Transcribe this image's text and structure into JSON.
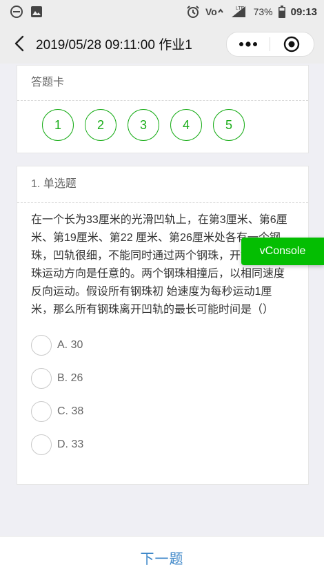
{
  "status_bar": {
    "icons_left": [
      "minus-circle-icon",
      "image-icon"
    ],
    "icons_right": [
      "alarm-icon",
      "volte-icon",
      "signal-icon"
    ],
    "lte_label": "LTE",
    "battery_percent": "73%",
    "time": "09:13"
  },
  "nav": {
    "title": "2019/05/28 09:11:00 作业1",
    "back_icon": "chevron-left-icon",
    "more_icon": "more-dots-icon",
    "close_icon": "record-circle-icon"
  },
  "answer_card": {
    "title": "答题卡",
    "numbers": [
      "1",
      "2",
      "3",
      "4",
      "5"
    ]
  },
  "question": {
    "header": "1. 单选题",
    "text": "在一个长为33厘米的光滑凹轨上，在第3厘米、第6厘米、第19厘米、第22 厘米、第26厘米处各有一个钢珠，凹轨很细，不能同时通过两个钢珠，开始时，钢珠运动方向是任意的。两个钢珠相撞后，以相同速度反向运动。假设所有钢珠初 始速度为每秒运动1厘米，那么所有钢珠离开凹轨的最长可能时间是（）",
    "options": [
      "A. 30",
      "B. 26",
      "C. 38",
      "D. 33"
    ]
  },
  "vconsole_label": "vConsole",
  "next_label": "下一题",
  "colors": {
    "accent_green": "#1aad19",
    "vconsole_green": "#04be02",
    "link_blue": "#3c86c8"
  }
}
